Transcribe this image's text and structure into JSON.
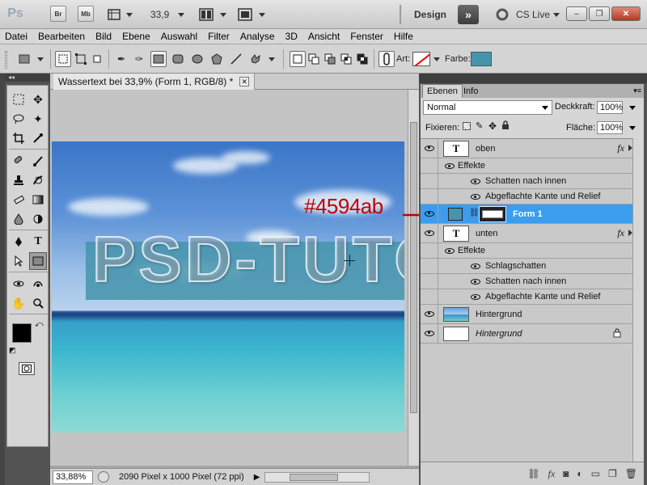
{
  "appbar": {
    "logo": "Ps",
    "br_label": "Br",
    "mb_label": "Mb",
    "zoom": "33,9",
    "workspace": "Design",
    "expand_symbol": "»",
    "cs_live": "CS Live",
    "minimize": "–",
    "restore": "❐",
    "close": "✕"
  },
  "menu": [
    "Datei",
    "Bearbeiten",
    "Bild",
    "Ebene",
    "Auswahl",
    "Filter",
    "Analyse",
    "3D",
    "Ansicht",
    "Fenster",
    "Hilfe"
  ],
  "options": {
    "art_label": "Art:",
    "farbe_label": "Farbe:",
    "farbe_color": "#4594ab"
  },
  "document": {
    "tab_title": "Wassertext bei 33,9% (Form 1, RGB/8) *",
    "watermark_text": "PSD-TUTO",
    "zoom_display": "33,88%",
    "size_info": "2090 Pixel x 1000 Pixel (72 ppi)"
  },
  "annotation": {
    "text": "#4594ab",
    "color": "#c00000"
  },
  "panel": {
    "tabs": [
      "Ebenen",
      "Info"
    ],
    "blend_mode": "Normal",
    "opacity_label": "Deckkraft:",
    "opacity_value": "100%",
    "lock_label": "Fixieren:",
    "fill_label": "Fläche:",
    "fill_value": "100%",
    "layers": {
      "oben": {
        "name": "oben",
        "thumb": "T"
      },
      "oben_effects": "Effekte",
      "oben_eff1": "Schatten nach innen",
      "oben_eff2": "Abgeflachte Kante und Relief",
      "form1": {
        "name": "Form 1",
        "color": "#4594ab"
      },
      "unten": {
        "name": "unten",
        "thumb": "T"
      },
      "unten_effects": "Effekte",
      "unten_eff1": "Schlagschatten",
      "unten_eff2": "Schatten nach innen",
      "unten_eff3": "Abgeflachte Kante und Relief",
      "hintergrund1": {
        "name": "Hintergrund"
      },
      "hintergrund2": {
        "name": "Hintergrund"
      }
    },
    "fx_label": "fx"
  }
}
